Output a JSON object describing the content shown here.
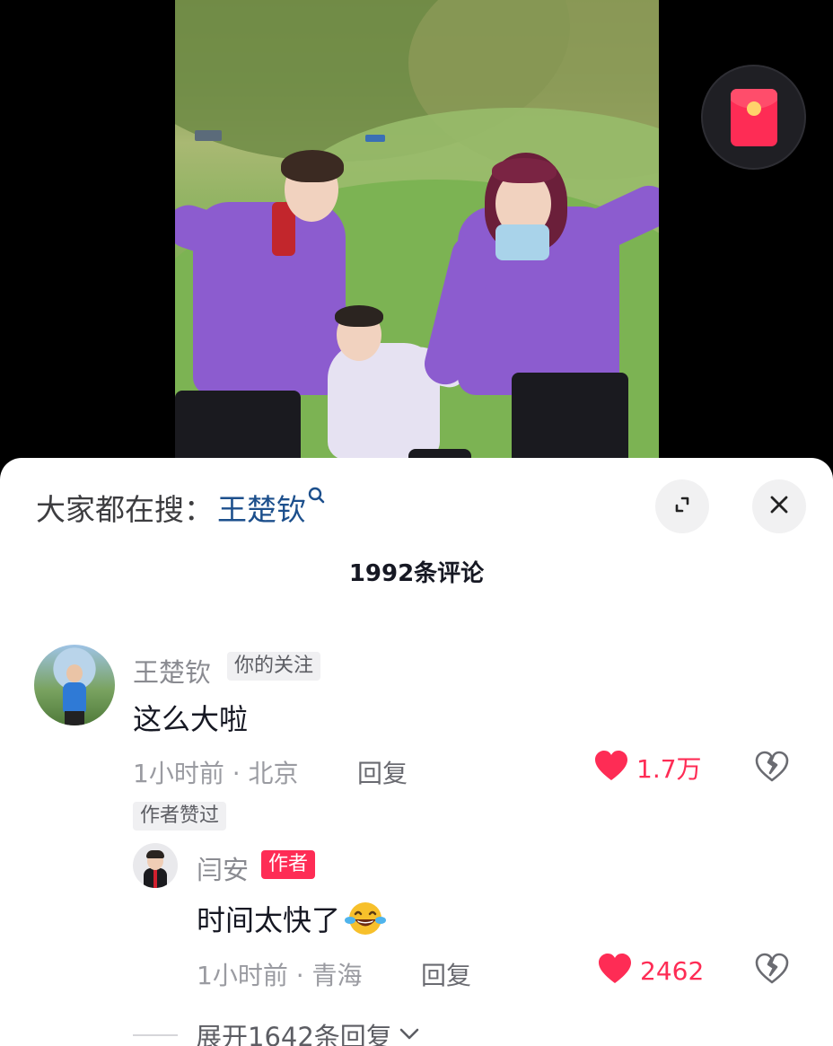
{
  "video": {
    "red_packet_icon": "red-packet-icon"
  },
  "comment_sheet": {
    "search_prefix": "大家都在搜：",
    "search_term": "王楚钦",
    "search_term_icon": "search-icon",
    "expand_icon": "fullscreen-icon",
    "close_icon": "close-icon",
    "comment_count": "1992条评论"
  },
  "comments": [
    {
      "username": "王楚钦",
      "badge": "你的关注",
      "text": "这么大啦",
      "time_location": "1小时前 · 北京",
      "reply_label": "回复",
      "like_count": "1.7万",
      "author_liked": "作者赞过",
      "replies": [
        {
          "username": "闫安",
          "badge": "作者",
          "text": "时间太快了",
          "emoji": "laughing-crying-emoji",
          "time_location": "1小时前 · 青海",
          "reply_label": "回复",
          "like_count": "2462"
        }
      ],
      "expand_replies_label": "展开1642条回复"
    }
  ],
  "colors": {
    "accent": "#fe2c55",
    "search_term": "#1c4f8c",
    "text_primary": "#161823",
    "text_secondary": "#8a8b91"
  }
}
